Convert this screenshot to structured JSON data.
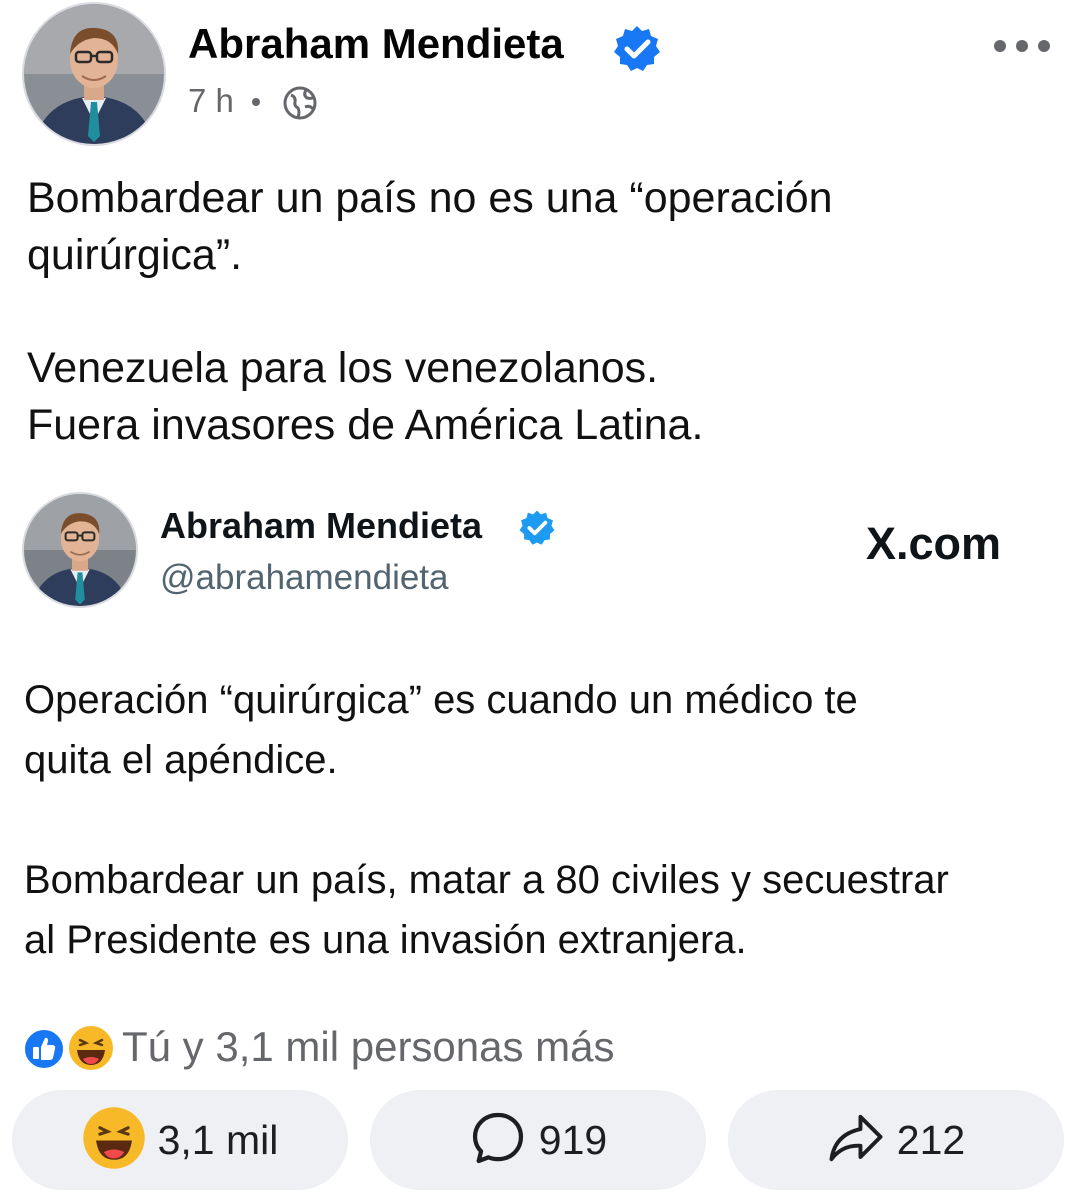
{
  "post": {
    "author": "Abraham Mendieta",
    "time": "7 h",
    "text_lines": [
      "Bombardear un país no es una “operación",
      "quirúrgica”.",
      "Venezuela para los venezolanos.",
      "Fuera invasores de América Latina."
    ]
  },
  "tweet": {
    "name": "Abraham Mendieta",
    "handle": "@abrahamendieta",
    "source": "X.com",
    "text_lines": [
      "Operación “quirúrgica” es cuando un médico te",
      "quita el apéndice.",
      "Bombardear un país, matar a 80 civiles y secuestrar",
      "al Presidente es una invasión extranjera."
    ]
  },
  "reactions": {
    "summary": "Tú y 3,1 mil personas más",
    "icons": [
      "like-icon",
      "haha-icon"
    ]
  },
  "actions": {
    "reactions_count": "3,1 mil",
    "comments_count": "919",
    "shares_count": "212"
  },
  "colors": {
    "verified": "#1877f2",
    "secondary_text": "#65676b",
    "action_bg": "#eef0f3"
  }
}
